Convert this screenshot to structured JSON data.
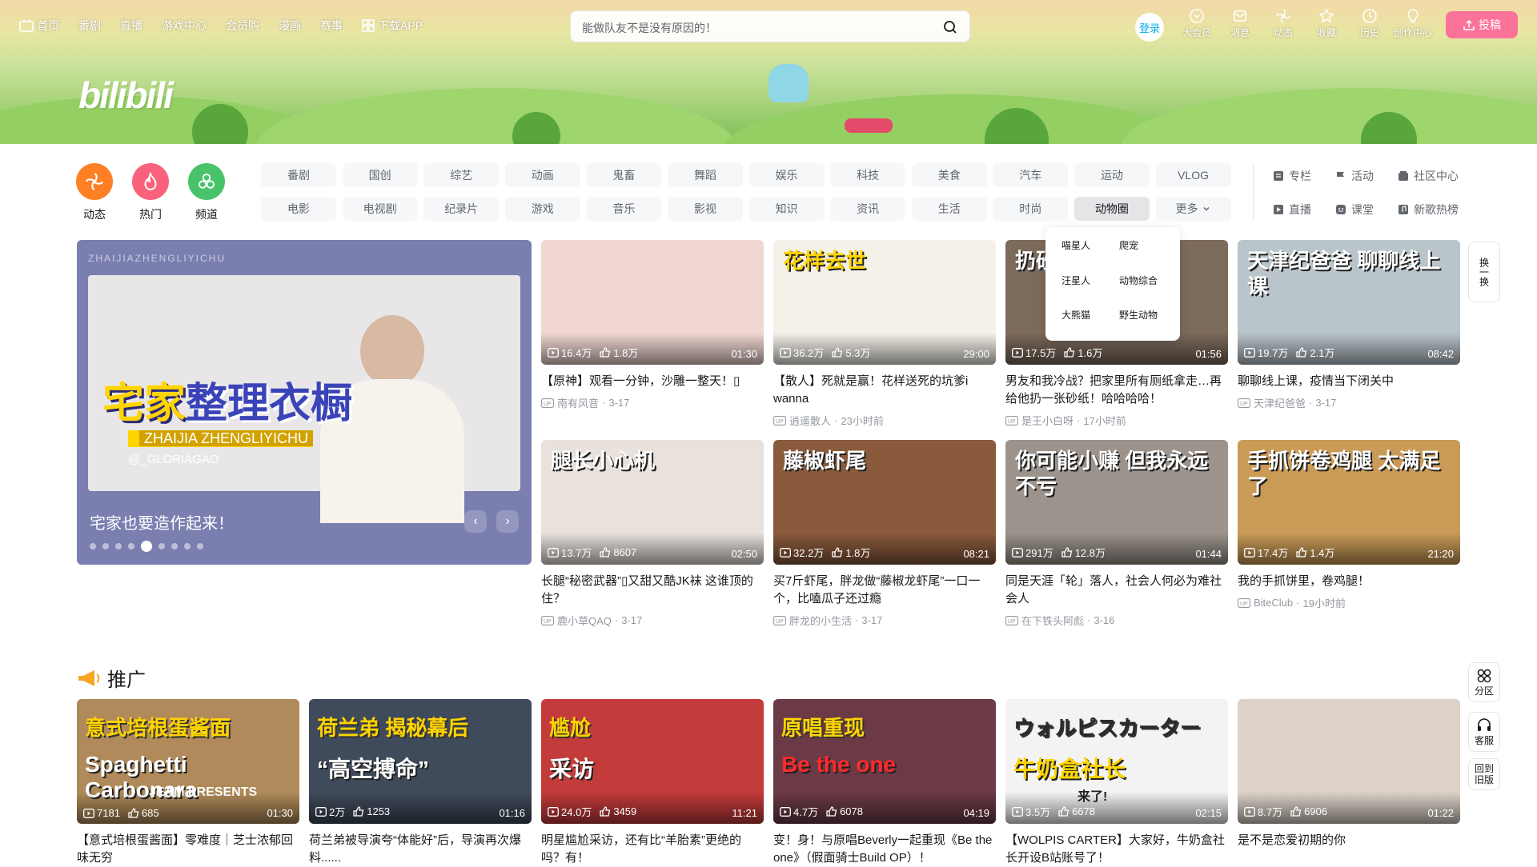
{
  "nav": {
    "left": [
      "首页",
      "番剧",
      "直播",
      "游戏中心",
      "会员购",
      "漫画",
      "赛事",
      "下载APP"
    ],
    "search_placeholder": "能做队友不是没有原因的！",
    "login": "登录",
    "right": [
      "大会员",
      "消息",
      "动态",
      "收藏",
      "历史",
      "创作中心"
    ],
    "upload": "投稿",
    "logo_text": "bilibili"
  },
  "channels": [
    {
      "label": "动态",
      "color": "#ff7f24",
      "icon": "fan-icon"
    },
    {
      "label": "热门",
      "color": "#f9627a",
      "icon": "fire-icon"
    },
    {
      "label": "频道",
      "color": "#48c36a",
      "icon": "channel-icon"
    }
  ],
  "tags": [
    "番剧",
    "国创",
    "综艺",
    "动画",
    "鬼畜",
    "舞蹈",
    "娱乐",
    "科技",
    "美食",
    "汽车",
    "运动",
    "VLOG",
    "电影",
    "电视剧",
    "纪录片",
    "游戏",
    "音乐",
    "影视",
    "知识",
    "资讯",
    "生活",
    "时尚",
    "动物圈",
    "更多"
  ],
  "side_links": [
    "专栏",
    "活动",
    "社区中心",
    "直播",
    "课堂",
    "新歌热榜"
  ],
  "dropdown": [
    "喵星人",
    "爬宠",
    "汪星人",
    "动物综合",
    "大熊猫",
    "野生动物"
  ],
  "carousel": {
    "title": "宅家也要造作起来！",
    "big1": "宅家",
    "big2": "整理衣橱",
    "sub": "ZHAIJIA ZHENGLIYICHU",
    "handle": "@_GLORIAGAO",
    "top_text": "ZHAIJIAZHENGLIYICHU",
    "dot_count": 9,
    "active_dot": 4
  },
  "videos": [
    {
      "views": "16.4万",
      "likes": "1.8万",
      "duration": "01:30",
      "title": "【原神】观看一分钟，沙雕一整天！▯",
      "author": "南有风音",
      "date": "3-17",
      "bg": "#f1d7d2",
      "overlay": ""
    },
    {
      "views": "36.2万",
      "likes": "5.3万",
      "duration": "29:00",
      "title": "【散人】死就是赢！花样送死的坑爹i wanna",
      "author": "逍遥散人",
      "date": "23小时前",
      "bg": "#f4f1e9",
      "overlay": "花样去世"
    },
    {
      "views": "17.5万",
      "likes": "1.6万",
      "duration": "01:56",
      "title": "男友和我冷战？把家里所有厕纸拿走…再给他扔一张砂纸！哈哈哈哈！",
      "author": "是王小白呀",
      "date": "17小时前",
      "bg": "#7c6a5b",
      "overlay": "扔砂"
    },
    {
      "views": "19.7万",
      "likes": "2.1万",
      "duration": "08:42",
      "title": "聊聊线上课，疫情当下闭关中",
      "author": "天津纪爸爸",
      "date": "3-17",
      "bg": "#b9c4cb",
      "overlay": "天津纪爸爸 聊聊线上课"
    },
    {
      "views": "13.7万",
      "likes": "8607",
      "duration": "02:50",
      "title": "长腿“秘密武器”▯又甜又酷JK袜 这谁顶的住？",
      "author": "鹿小草QAQ",
      "date": "3-17",
      "bg": "#e8e1dc",
      "overlay": "腿长小心机"
    },
    {
      "views": "32.2万",
      "likes": "1.8万",
      "duration": "08:21",
      "title": "买7斤虾尾，胖龙做“藤椒龙虾尾”一口一个，比嗑瓜子还过瘾",
      "author": "胖龙的小生活",
      "date": "3-17",
      "bg": "#8a5a3c",
      "overlay": "藤椒虾尾"
    },
    {
      "views": "291万",
      "likes": "12.8万",
      "duration": "01:44",
      "title": "同是天涯「轮」落人，社会人何必为难社会人",
      "author": "在下铁头阿彪",
      "date": "3-16",
      "bg": "#9c948c",
      "overlay": "你可能小赚 但我永远不亏"
    },
    {
      "views": "17.4万",
      "likes": "1.4万",
      "duration": "21:20",
      "title": "我的手抓饼里，卷鸡腿！",
      "author": "BiteClub",
      "date": "19小时前",
      "bg": "#c99b57",
      "overlay": "手抓饼卷鸡腿 太满足了"
    }
  ],
  "promo": {
    "title": "推广",
    "items": [
      {
        "views": "7181",
        "likes": "685",
        "duration": "01:30",
        "title": "【意式培根蛋酱面】零难度｜芝士浓郁回味无穷",
        "bg": "#b08a5a",
        "overlay": "意式培根蛋酱面",
        "overlay2": "Spaghetti Carbonara",
        "overlay3": "JEAM PRESENTS"
      },
      {
        "views": "2万",
        "likes": "1253",
        "duration": "01:16",
        "title": "荷兰弟被导演夸“体能好”后，导演再次爆料......",
        "bg": "#3f4a5a",
        "overlay": "荷兰弟 揭秘幕后",
        "overlay2": "“高空搏命”",
        "overlay3": ""
      },
      {
        "views": "24.0万",
        "likes": "3459",
        "duration": "11:21",
        "title": "明星尴尬采访，还有比“羊胎素”更绝的吗？有！",
        "bg": "#c43b3b",
        "overlay": "尴尬",
        "overlay2": "采访",
        "overlay3": ""
      },
      {
        "views": "4.7万",
        "likes": "6078",
        "duration": "04:19",
        "title": "变！身！与原唱Beverly一起重现《Be the one》（假面骑士Build OP）！",
        "bg": "#6b3a46",
        "overlay": "原唱重现",
        "overlay2": "Be the one",
        "overlay3": ""
      },
      {
        "views": "3.5万",
        "likes": "6678",
        "duration": "02:15",
        "title": "【WOLPIS CARTER】大家好，牛奶盒社长开设B站账号了！",
        "bg": "#f3f3f3",
        "overlay": "ウォルピスカーター",
        "overlay2": "牛奶盒社长",
        "overlay3": "来了!"
      },
      {
        "views": "8.7万",
        "likes": "6906",
        "duration": "01:22",
        "title": "是不是恋爱初期的你",
        "bg": "#dcd2c8",
        "overlay": "",
        "overlay2": "",
        "overlay3": ""
      }
    ]
  },
  "float": [
    "换一换",
    "分区",
    "客服",
    "回到旧版"
  ],
  "colors": {
    "accent": "#00aeec",
    "pink": "#fb7299"
  }
}
